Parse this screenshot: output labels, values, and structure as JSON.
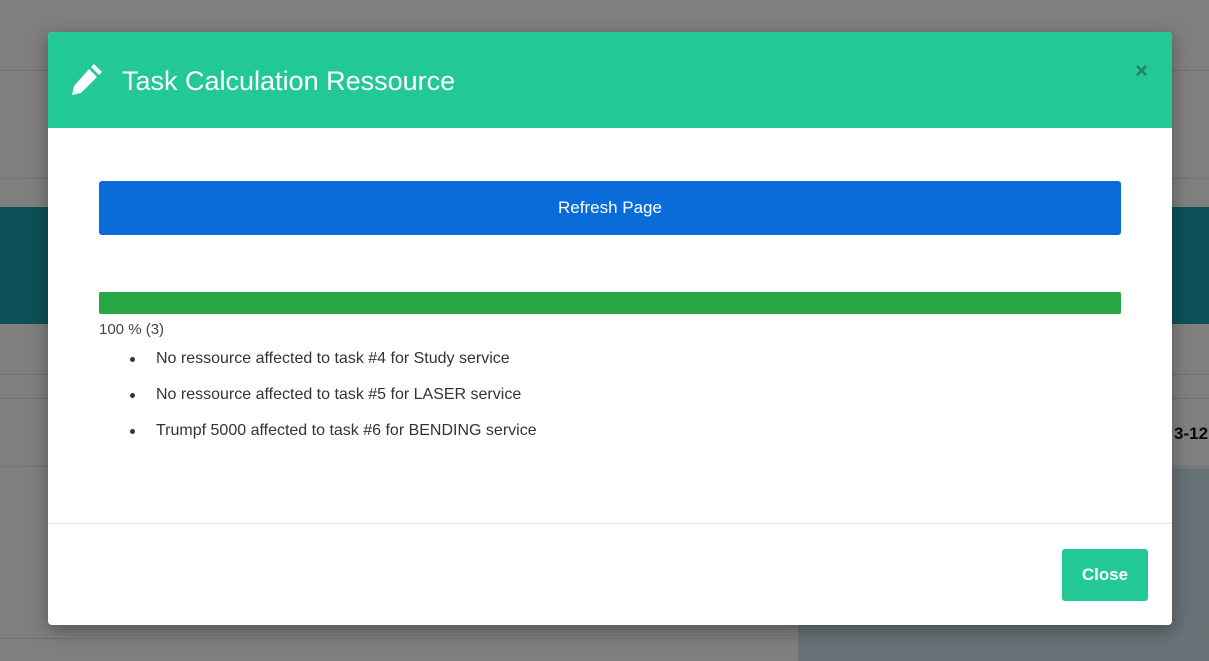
{
  "background": {
    "edge_text": "3-12"
  },
  "modal": {
    "title": "Task Calculation Ressource",
    "header_icon": "pencil-icon",
    "close_icon": "close-icon",
    "close_symbol": "×",
    "refresh_button_label": "Refresh Page",
    "progress": {
      "percent": 100,
      "label": "100 % (3)"
    },
    "results": [
      "No ressource affected to task #4 for Study service",
      "No ressource affected to task #5 for LASER service",
      "Trumpf 5000 affected to task #6 for BENDING service"
    ],
    "close_button_label": "Close"
  },
  "colors": {
    "header": "#22c997",
    "refresh_button": "#0a6cd9",
    "progress_fill": "#28a745",
    "close_button": "#22c997"
  }
}
